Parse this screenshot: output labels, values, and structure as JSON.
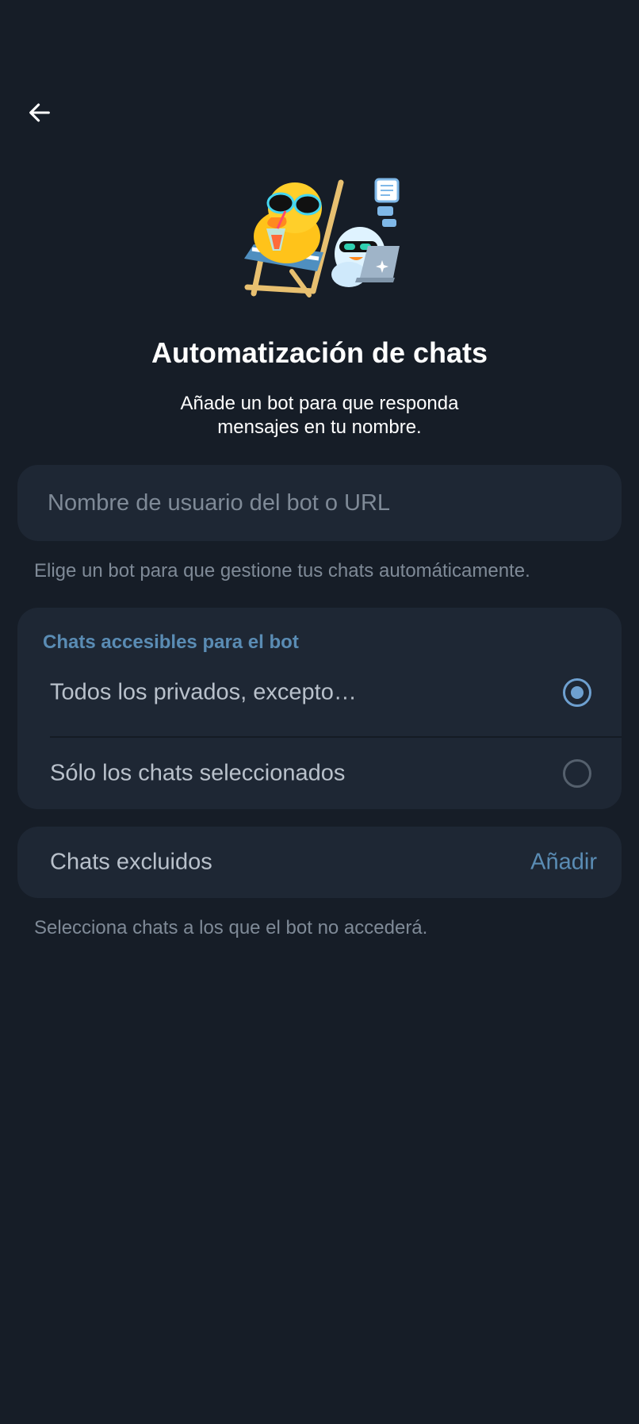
{
  "header": {
    "back_icon": "arrow-left-icon"
  },
  "hero": {
    "icon": "duck-beach-bot-sticker"
  },
  "title": "Automatización de chats",
  "subtitle": "Añade un bot para que responda mensajes en tu nombre.",
  "bot_input": {
    "placeholder": "Nombre de usuario del bot o URL",
    "value": "",
    "hint": "Elige un bot para que gestione tus chats automáticamente."
  },
  "access": {
    "header": "Chats accesibles para el bot",
    "options": [
      {
        "label": "Todos los privados, excepto…",
        "selected": true
      },
      {
        "label": "Sólo los chats seleccionados",
        "selected": false
      }
    ]
  },
  "excluded": {
    "label": "Chats excluidos",
    "action": "Añadir",
    "hint": "Selecciona chats a los que el bot no accederá."
  },
  "colors": {
    "background": "#161d27",
    "card": "#1e2734",
    "accent": "#5a8cb4",
    "radio_active": "#6ea0d0",
    "secondary_text": "#7f8a97"
  }
}
